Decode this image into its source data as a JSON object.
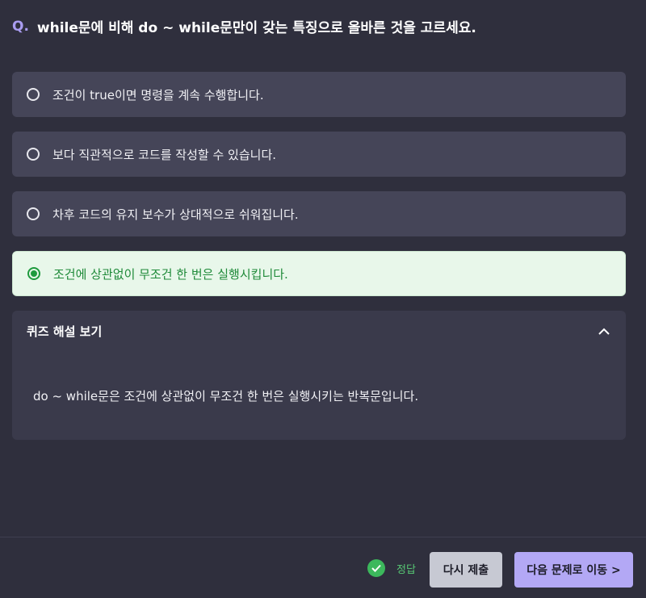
{
  "question": {
    "prefix": "Q.",
    "text": "while문에 비해 do ~ while문만이 갖는 특징으로 올바른 것을 고르세요."
  },
  "options": [
    {
      "label": "조건이 true이면 명령을 계속 수행합니다.",
      "selected": false
    },
    {
      "label": "보다 직관적으로 코드를 작성할 수 있습니다.",
      "selected": false
    },
    {
      "label": "차후 코드의 유지 보수가 상대적으로 쉬워집니다.",
      "selected": false
    },
    {
      "label": "조건에 상관없이 무조건 한 번은 실행시킵니다.",
      "selected": true
    }
  ],
  "explanation": {
    "title": "퀴즈 해설 보기",
    "expanded_icon": "chevron-up-icon",
    "text": "do ~ while문은 조건에 상관없이 무조건 한 번은 실행시키는 반복문입니다."
  },
  "footer": {
    "status_icon": "check-circle-icon",
    "status_label": "정답",
    "retry_label": "다시 제출",
    "next_label": "다음 문제로 이동 >"
  },
  "colors": {
    "background": "#2f2f3d",
    "option_bg": "#454558",
    "selected_bg": "#e8f7ea",
    "selected_text": "#1f8a39",
    "accent": "#b3a8f5",
    "correct": "#3cb85c"
  }
}
